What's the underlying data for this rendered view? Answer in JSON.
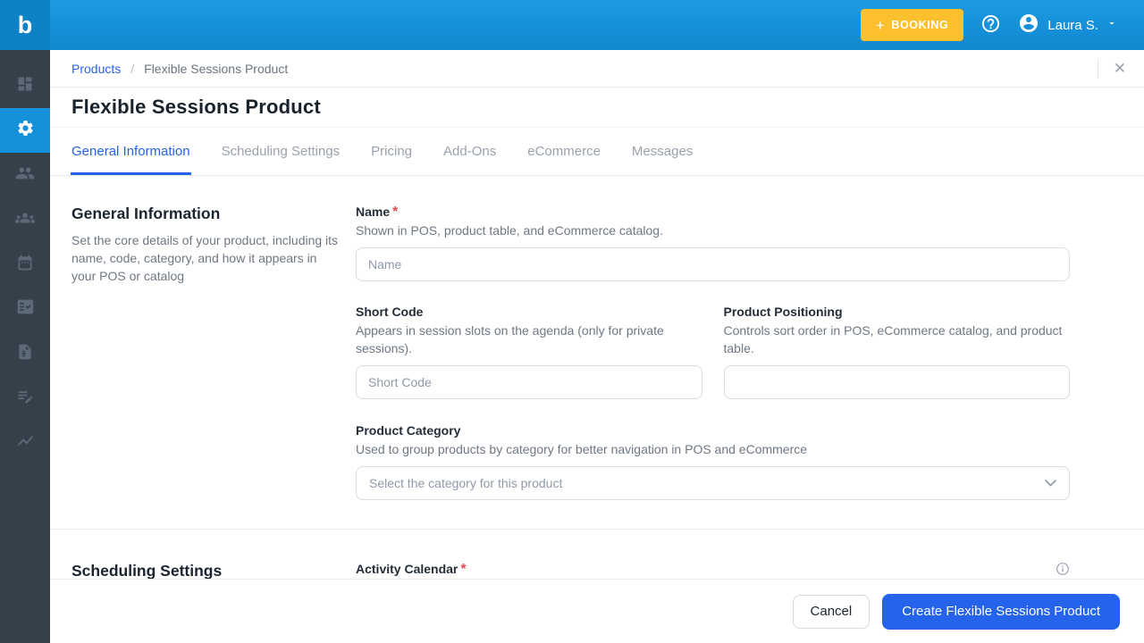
{
  "topbar": {
    "logo_text": "b",
    "booking_plus": "+",
    "booking_label": "BOOKING",
    "user_name": "Laura S."
  },
  "sidebar": {
    "items": [
      {
        "icon": "dashboard-icon",
        "active": false
      },
      {
        "icon": "settings-gear-icon",
        "active": true
      },
      {
        "icon": "users-icon",
        "active": false
      },
      {
        "icon": "group-icon",
        "active": false
      },
      {
        "icon": "calendar-icon",
        "active": false
      },
      {
        "icon": "checklist-icon",
        "active": false
      },
      {
        "icon": "invoice-icon",
        "active": false
      },
      {
        "icon": "note-edit-icon",
        "active": false
      },
      {
        "icon": "trend-chart-icon",
        "active": false
      }
    ]
  },
  "breadcrumb": {
    "products_link": "Products",
    "separator": "/",
    "current_page": "Flexible Sessions Product"
  },
  "page_title": "Flexible Sessions Product",
  "tabs": [
    {
      "label": "General Information",
      "active": true
    },
    {
      "label": "Scheduling Settings",
      "active": false
    },
    {
      "label": "Pricing",
      "active": false
    },
    {
      "label": "Add-Ons",
      "active": false
    },
    {
      "label": "eCommerce",
      "active": false
    },
    {
      "label": "Messages",
      "active": false
    }
  ],
  "general_section": {
    "heading": "General Information",
    "description": "Set the core details of your product, including its name, code, category, and how it appears in your POS or catalog",
    "name_field": {
      "label": "Name",
      "required_mark": "*",
      "help": "Shown in POS, product table, and eCommerce catalog.",
      "placeholder": "Name",
      "value": ""
    },
    "short_code_field": {
      "label": "Short Code",
      "help": "Appears in session slots on the agenda (only for private sessions).",
      "placeholder": "Short Code",
      "value": ""
    },
    "positioning_field": {
      "label": "Product Positioning",
      "help": "Controls sort order in POS, eCommerce catalog, and product table.",
      "placeholder": "",
      "value": ""
    },
    "category_field": {
      "label": "Product Category",
      "help": "Used to group products by category for better navigation in POS and eCommerce",
      "placeholder": "Select the category for this product"
    }
  },
  "scheduling_section": {
    "heading": "Scheduling Settings",
    "activity_calendar_field": {
      "label": "Activity Calendar",
      "required_mark": "*"
    }
  },
  "footer": {
    "cancel_label": "Cancel",
    "submit_label": "Create Flexible Sessions Product"
  },
  "colors": {
    "topbar_blue": "#1591dc",
    "sidebar_dark": "#36404a",
    "accent_blue": "#2563eb",
    "booking_yellow": "#fcc02e",
    "required_red": "#e5484d"
  }
}
